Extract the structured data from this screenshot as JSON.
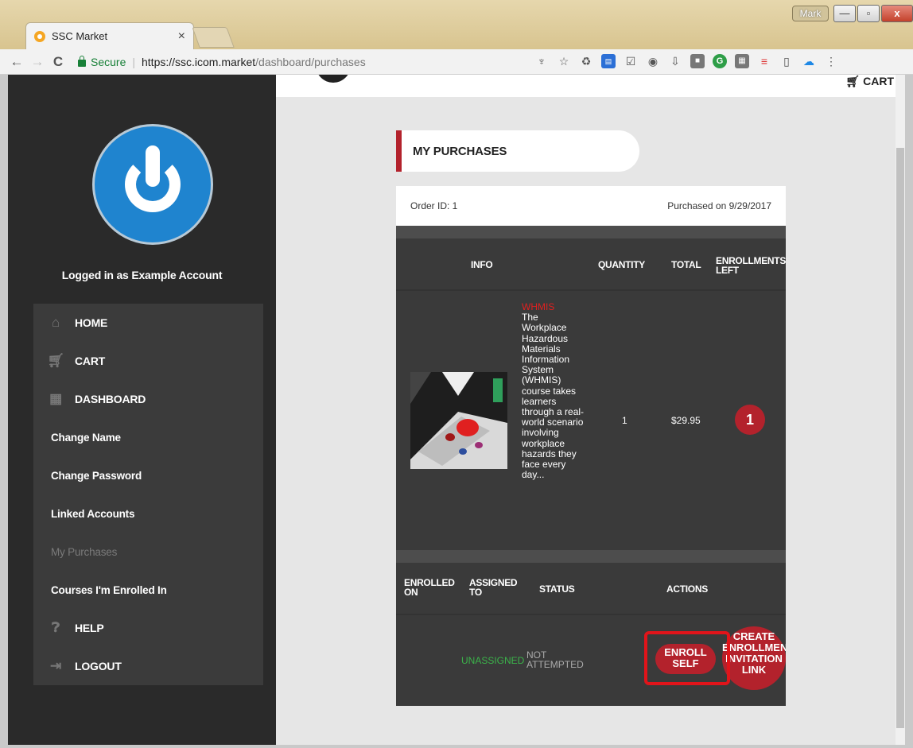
{
  "browser": {
    "tab_title": "SSC Market",
    "tab_close": "×",
    "user": "Mark",
    "secure_label": "Secure",
    "url_host": "https://ssc.icom.market",
    "url_path": "/dashboard/purchases",
    "nav": {
      "back": "←",
      "forward": "→",
      "reload": "C"
    },
    "window": {
      "min": "—",
      "max": "▫",
      "close": "x"
    },
    "extensions": [
      "pin-icon",
      "star-icon",
      "recycle-icon",
      "screen-new-icon",
      "checkbox-icon",
      "eye-icon",
      "download-arrow-icon",
      "square-icon",
      "grammarly-icon",
      "gray-box-icon",
      "filter-icon",
      "pdf-icon",
      "cloud-icon",
      "menu-dots-icon"
    ]
  },
  "header": {
    "cart_label": "CART"
  },
  "sidebar": {
    "logged_in": "Logged in as Example Account",
    "items": [
      {
        "label": "HOME",
        "icon": "home-icon"
      },
      {
        "label": "CART",
        "icon": "cart-icon"
      },
      {
        "label": "DASHBOARD",
        "icon": "dashboard-icon"
      },
      {
        "label": "Change Name"
      },
      {
        "label": "Change Password"
      },
      {
        "label": "Linked Accounts"
      },
      {
        "label": "My Purchases"
      },
      {
        "label": "Courses I'm Enrolled In"
      },
      {
        "label": "HELP",
        "icon": "help-icon"
      },
      {
        "label": "LOGOUT",
        "icon": "logout-icon"
      }
    ]
  },
  "purchases": {
    "title": "MY PURCHASES",
    "order_id": "Order ID: 1",
    "purchased_on": "Purchased on 9/29/2017",
    "columns": {
      "info": "INFO",
      "quantity": "QUANTITY",
      "total": "TOTAL",
      "enrollments_left": "ENROLLMENTS LEFT"
    },
    "item": {
      "course": "WHMIS",
      "description": "The Workplace Hazardous Materials Information System (WHMIS) course takes learners through a real-world scenario involving workplace hazards they face every day...",
      "quantity": "1",
      "total": "$29.95",
      "enrollments_left": "1"
    },
    "enroll_columns": {
      "enrolled_on": "ENROLLED ON",
      "assigned_to": "ASSIGNED TO",
      "status": "STATUS",
      "actions": "ACTIONS"
    },
    "enrollment": {
      "assigned": "UNASSIGNED",
      "status": "NOT ATTEMPTED",
      "enroll_self": "ENROLL SELF",
      "invite_link": "CREATE ENROLLMENT INVITATION LINK"
    }
  }
}
